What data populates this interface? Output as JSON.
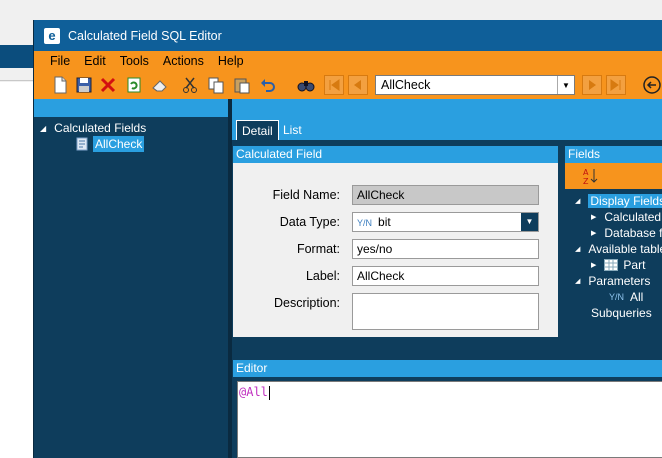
{
  "window": {
    "title": "Calculated Field SQL Editor"
  },
  "menu": [
    "File",
    "Edit",
    "Tools",
    "Actions",
    "Help"
  ],
  "toolbar": {
    "icons": [
      "new-icon",
      "save-icon",
      "delete-icon",
      "refresh-icon",
      "eraser-icon",
      "cut-icon",
      "copy-icon",
      "paste-icon",
      "undo-icon",
      "find-icon",
      "first-record-icon",
      "prev-record-icon",
      "next-record-icon",
      "last-record-icon",
      "back-icon"
    ],
    "record_selector": "AllCheck"
  },
  "tree": {
    "root": "Calculated Fields",
    "selected_item": "AllCheck"
  },
  "tabs": {
    "detail": "Detail",
    "list": "List"
  },
  "calculated_field": {
    "header": "Calculated Field",
    "field_name_label": "Field Name:",
    "field_name_value": "AllCheck",
    "data_type_label": "Data Type:",
    "data_type_prefix": "Y/N",
    "data_type_value": "bit",
    "format_label": "Format:",
    "format_value": "yes/no",
    "label_label": "Label:",
    "label_value": "AllCheck",
    "description_label": "Description:",
    "description_value": ""
  },
  "fields_panel": {
    "header": "Fields",
    "items": {
      "display_fields": "Display Fields",
      "calculated": "Calculated",
      "database_fields": "Database fi",
      "available_tables": "Available tables",
      "part": "Part",
      "parameters": "Parameters",
      "all_prefix": "Y/N",
      "all": "All",
      "subqueries": "Subqueries"
    }
  },
  "editor": {
    "header": "Editor",
    "code": "@All"
  },
  "colors": {
    "accent_orange": "#f7941d",
    "title_blue": "#0f5f99",
    "panel_navy": "#0e3d5c",
    "header_blue": "#2a9fe0",
    "code_magenta": "#c030c0"
  }
}
